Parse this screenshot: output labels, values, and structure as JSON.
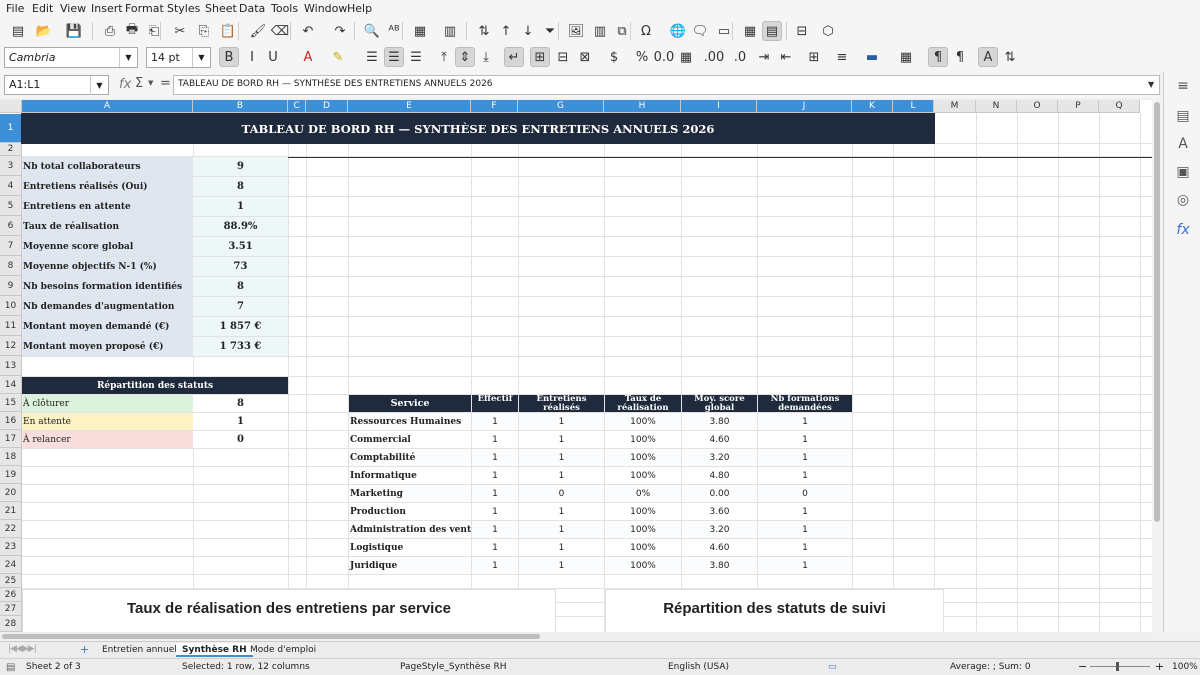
{
  "menu": [
    "File",
    "Edit",
    "View",
    "Insert",
    "Format",
    "Styles",
    "Sheet",
    "Data",
    "Tools",
    "Window",
    "Help"
  ],
  "toolbar": {
    "font_name": "Cambria",
    "font_size": "14 pt"
  },
  "formula": {
    "name_box": "A1:L1",
    "content": "TABLEAU DE BORD RH — SYNTHÈSE DES ENTRETIENS ANNUELS 2026"
  },
  "columns": [
    "A",
    "B",
    "C",
    "D",
    "E",
    "F",
    "G",
    "H",
    "I",
    "J",
    "K",
    "L",
    "M",
    "N",
    "O",
    "P",
    "Q"
  ],
  "rows": [
    "1",
    "2",
    "3",
    "4",
    "5",
    "6",
    "7",
    "8",
    "9",
    "10",
    "11",
    "12",
    "13",
    "14",
    "15",
    "16",
    "17",
    "18",
    "19",
    "20",
    "21",
    "22",
    "23",
    "24",
    "25",
    "26",
    "27",
    "28"
  ],
  "title": "TABLEAU DE BORD RH — SYNTHÈSE DES ENTRETIENS ANNUELS 2026",
  "kpis": [
    {
      "label": "Nb total collaborateurs",
      "value": "9"
    },
    {
      "label": "Entretiens réalisés (Oui)",
      "value": "8"
    },
    {
      "label": "Entretiens en attente",
      "value": "1"
    },
    {
      "label": "Taux de réalisation",
      "value": "88.9%"
    },
    {
      "label": "Moyenne score global",
      "value": "3.51"
    },
    {
      "label": "Moyenne objectifs N-1 (%)",
      "value": "73"
    },
    {
      "label": "Nb besoins formation identifiés",
      "value": "8"
    },
    {
      "label": "Nb demandes d'augmentation",
      "value": "7"
    },
    {
      "label": "Montant moyen demandé (€)",
      "value": "1 857 €"
    },
    {
      "label": "Montant moyen proposé (€)",
      "value": "1 733 €"
    }
  ],
  "status_title": "Répartition des statuts",
  "statuses": [
    {
      "label": "À clôturer",
      "value": "8",
      "color": "#dcf2dc"
    },
    {
      "label": "En attente",
      "value": "1",
      "color": "#fdf2c4"
    },
    {
      "label": "À relancer",
      "value": "0",
      "color": "#f9dede"
    }
  ],
  "service_table": {
    "headers": [
      "Service",
      "Effectif",
      "Entretiens réalisés",
      "Taux de réalisation",
      "Moy. score global",
      "Nb formations demandées"
    ],
    "rows": [
      [
        "Ressources Humaines",
        "1",
        "1",
        "100%",
        "3.80",
        "1"
      ],
      [
        "Commercial",
        "1",
        "1",
        "100%",
        "4.60",
        "1"
      ],
      [
        "Comptabilité",
        "1",
        "1",
        "100%",
        "3.20",
        "1"
      ],
      [
        "Informatique",
        "1",
        "1",
        "100%",
        "4.80",
        "1"
      ],
      [
        "Marketing",
        "1",
        "0",
        "0%",
        "0.00",
        "0"
      ],
      [
        "Production",
        "1",
        "1",
        "100%",
        "3.60",
        "1"
      ],
      [
        "Administration des ventes",
        "1",
        "1",
        "100%",
        "3.20",
        "1"
      ],
      [
        "Logistique",
        "1",
        "1",
        "100%",
        "4.60",
        "1"
      ],
      [
        "Juridique",
        "1",
        "1",
        "100%",
        "3.80",
        "1"
      ]
    ]
  },
  "charts": {
    "left_title": "Taux de réalisation des entretiens par service",
    "right_title": "Répartition des statuts de suivi"
  },
  "sheets": [
    "Entretien annuel",
    "Synthèse RH",
    "Mode d'emploi"
  ],
  "status": {
    "sheet": "Sheet 2 of 3",
    "selection": "Selected: 1 row, 12 columns",
    "page_style": "PageStyle_Synthèse RH",
    "language": "English (USA)",
    "sum": "Average: ; Sum: 0",
    "zoom": "100%"
  },
  "colors": {
    "header_dark": "#1f2a3d",
    "selection_blue": "#3d8fd8",
    "kpi_label_bg": "#dfe6f0",
    "kpi_value_bg": "#eef7f7"
  }
}
